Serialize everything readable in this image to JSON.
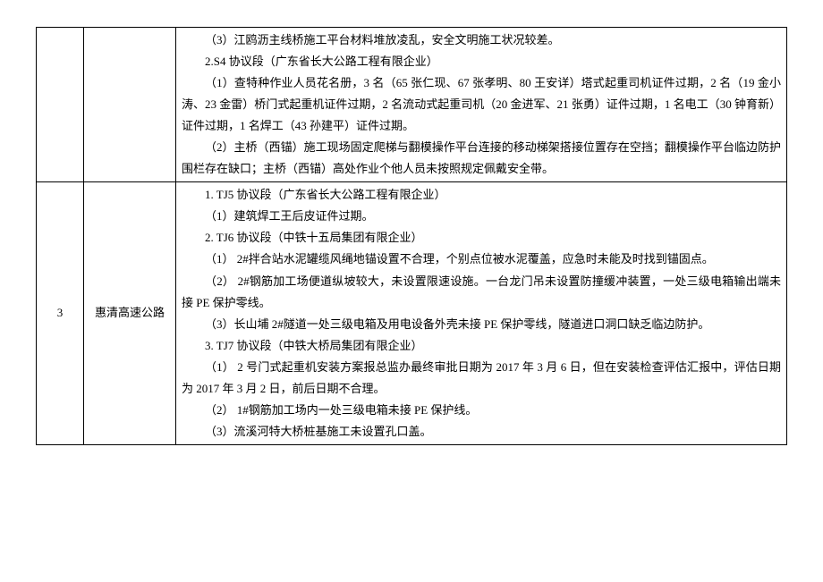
{
  "rows": [
    {
      "idx": "",
      "project": "",
      "lines": [
        {
          "cls": "indent",
          "text": "（3）江鸥沥主线桥施工平台材料堆放凌乱，安全文明施工状况较差。"
        },
        {
          "cls": "indent",
          "text": "2.S4 协议段（广东省长大公路工程有限企业）"
        },
        {
          "cls": "indent",
          "text": "（1）查特种作业人员花名册，3 名（65 张仁现、67 张孝明、80 王安详）塔式起重司机证件过期，2 名（19 金小涛、23 金雷）桥门式起重机证件过期，2 名流动式起重司机（20 金进军、21 张勇）证件过期，1 名电工（30 钟育新）证件过期，1 名焊工（43 孙建平）证件过期。"
        },
        {
          "cls": "indent",
          "text": "（2）主桥（西锚）施工现场固定爬梯与翻模操作平台连接的移动梯架搭接位置存在空挡；翻模操作平台临边防护围栏存在缺口；主桥（西锚）高处作业个他人员未按照规定佩戴安全带。"
        }
      ]
    },
    {
      "idx": "3",
      "project": "惠清高速公路",
      "lines": [
        {
          "cls": "indent",
          "text": "1. TJ5 协议段（广东省长大公路工程有限企业）"
        },
        {
          "cls": "indent",
          "text": "（1）建筑焊工王后皮证件过期。"
        },
        {
          "cls": "indent",
          "text": "2. TJ6 协议段（中铁十五局集团有限企业）"
        },
        {
          "cls": "indent",
          "text": "（1）   2#拌合站水泥罐缆风绳地锚设置不合理，个别点位被水泥覆盖，应急时未能及时找到锚固点。"
        },
        {
          "cls": "indent",
          "text": "（2）   2#钢筋加工场便道纵坡较大，未设置限速设施。一台龙门吊未设置防撞缓冲装置，一处三级电箱输出端未接 PE 保护零线。"
        },
        {
          "cls": "indent",
          "text": "（3）长山埔 2#隧道一处三级电箱及用电设备外壳未接 PE 保护零线，隧道进口洞口缺乏临边防护。"
        },
        {
          "cls": "indent",
          "text": "3. TJ7 协议段（中铁大桥局集团有限企业）"
        },
        {
          "cls": "indent",
          "text": "（1）   2 号门式起重机安装方案报总监办最终审批日期为 2017 年 3 月 6 日，但在安装检查评估汇报中，评估日期为 2017 年 3 月 2 日，前后日期不合理。"
        },
        {
          "cls": "indent",
          "text": "（2）   1#钢筋加工场内一处三级电箱未接 PE 保护线。"
        },
        {
          "cls": "indent",
          "text": "（3）流溪河特大桥桩基施工未设置孔口盖。"
        }
      ]
    }
  ]
}
